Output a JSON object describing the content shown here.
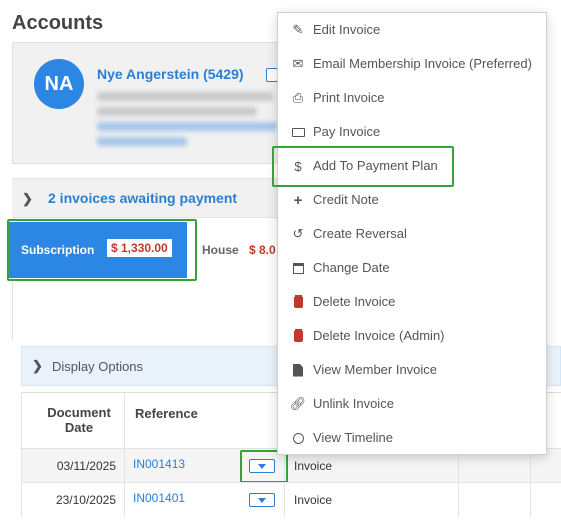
{
  "page": {
    "title": "Accounts"
  },
  "member": {
    "initials": "NA",
    "name": "Nye Angerstein (5429)"
  },
  "invoices_banner": {
    "text": "2 invoices awaiting payment"
  },
  "tabs": [
    {
      "label": "Subscription",
      "amount": "$ 1,330.00",
      "active": true
    },
    {
      "label": "House",
      "amount": "$ 8.0"
    }
  ],
  "display_options": {
    "label": "Display Options"
  },
  "table": {
    "headers": [
      "Document Date",
      "Reference"
    ],
    "rows": [
      {
        "date": "03/11/2025",
        "reference": "IN001413",
        "type": "Invoice"
      },
      {
        "date": "23/10/2025",
        "reference": "IN001401",
        "type": "Invoice"
      }
    ]
  },
  "menu": {
    "items": [
      {
        "label": "Edit Invoice",
        "icon": "pencil-icon"
      },
      {
        "label": "Email Membership Invoice (Preferred)",
        "icon": "envelope-icon"
      },
      {
        "label": "Print Invoice",
        "icon": "printer-icon"
      },
      {
        "label": "Pay Invoice",
        "icon": "money-icon"
      },
      {
        "label": "Add To Payment Plan",
        "icon": "dollar-icon"
      },
      {
        "label": "Credit Note",
        "icon": "plus-icon"
      },
      {
        "label": "Create Reversal",
        "icon": "undo-icon"
      },
      {
        "label": "Change Date",
        "icon": "calendar-icon"
      },
      {
        "label": "Delete Invoice",
        "icon": "trash-icon"
      },
      {
        "label": "Delete Invoice (Admin)",
        "icon": "trash-icon"
      },
      {
        "label": "View Member Invoice",
        "icon": "file-icon"
      },
      {
        "label": "Unlink Invoice",
        "icon": "unlink-icon"
      },
      {
        "label": "View Timeline",
        "icon": "clock-icon"
      }
    ]
  },
  "colors": {
    "accent": "#2b87e3",
    "amount": "#c0392b",
    "highlight": "#35a33a",
    "delete": "#c0392b"
  }
}
